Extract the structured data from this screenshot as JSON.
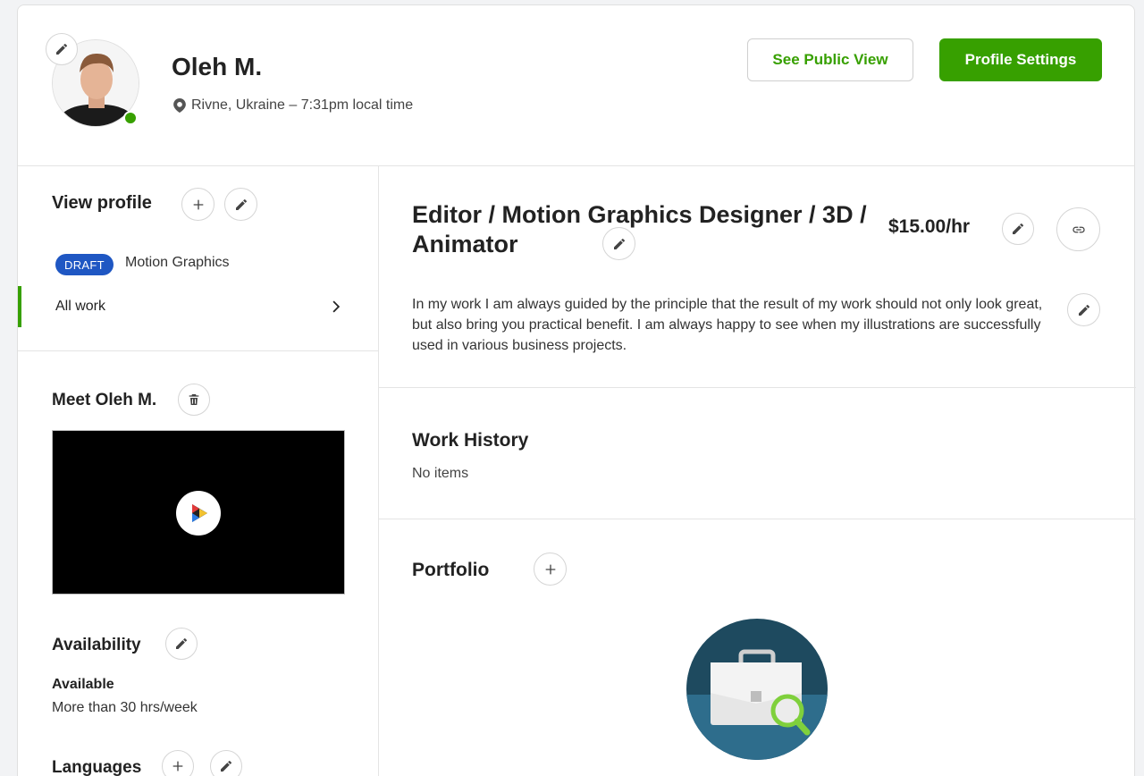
{
  "header": {
    "name": "Oleh M.",
    "location": "Rivne, Ukraine – 7:31pm local time",
    "see_public_view": "See Public View",
    "profile_settings": "Profile Settings"
  },
  "sidebar": {
    "view_profile_title": "View profile",
    "draft_badge": "DRAFT",
    "draft_label": "Motion Graphics",
    "all_work": "All work",
    "meet_title": "Meet Oleh M.",
    "availability_title": "Availability",
    "availability_status": "Available",
    "availability_hours": "More than 30 hrs/week",
    "languages_title": "Languages"
  },
  "main": {
    "headline": "Editor / Motion Graphics Designer / 3D / Animator",
    "rate": "$15.00/hr",
    "overview": "In my work I am always guided by the principle that the result of my work should not only look great, but also bring you practical benefit. I am always happy to see when my illustrations are successfully used in various business projects.",
    "work_history_title": "Work History",
    "work_history_empty": "No items",
    "portfolio_title": "Portfolio"
  },
  "colors": {
    "brand_green": "#37a000",
    "draft_blue": "#1f57c3",
    "illus_dark": "#1e4a5f",
    "illus_light": "#2e6d8c"
  }
}
